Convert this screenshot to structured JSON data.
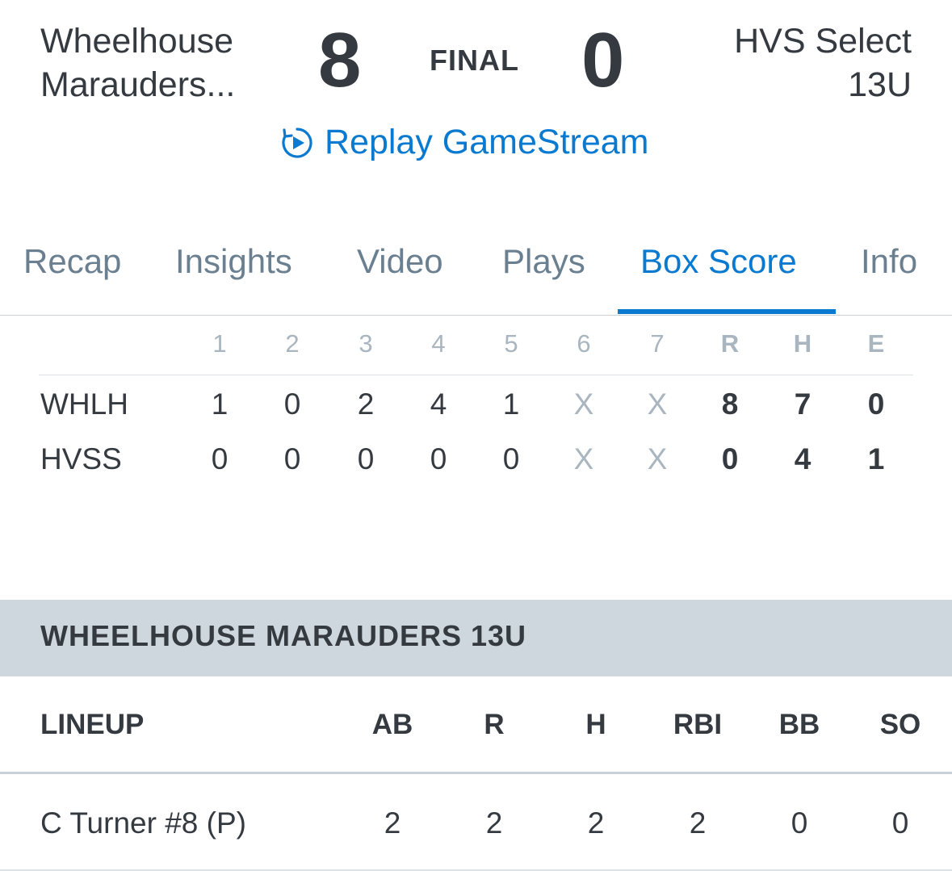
{
  "header": {
    "away_team": "Wheelhouse Marauders...",
    "away_team_line1": "Wheelhouse",
    "away_team_line2": "Marauders...",
    "home_team_line1": "HVS Select",
    "home_team_line2": "13U",
    "away_score": "8",
    "home_score": "0",
    "status": "FINAL",
    "replay_label": "Replay GameStream",
    "replay_icon": "replay-icon",
    "accent_color": "#0a7ad1"
  },
  "tabs": [
    {
      "label": "Recap"
    },
    {
      "label": "Insights"
    },
    {
      "label": "Video"
    },
    {
      "label": "Plays"
    },
    {
      "label": "Box Score",
      "active": true
    },
    {
      "label": "Info"
    }
  ],
  "linescore": {
    "headers": [
      "1",
      "2",
      "3",
      "4",
      "5",
      "6",
      "7",
      "R",
      "H",
      "E"
    ],
    "rows": [
      {
        "team": "WHLH",
        "innings": [
          "1",
          "0",
          "2",
          "4",
          "1",
          "X",
          "X"
        ],
        "R": "8",
        "H": "7",
        "E": "0"
      },
      {
        "team": "HVSS",
        "innings": [
          "0",
          "0",
          "0",
          "0",
          "0",
          "X",
          "X"
        ],
        "R": "0",
        "H": "4",
        "E": "1"
      }
    ]
  },
  "section": {
    "title": "WHEELHOUSE MARAUDERS 13U"
  },
  "lineup": {
    "label": "LINEUP",
    "columns": [
      "AB",
      "R",
      "H",
      "RBI",
      "BB",
      "SO"
    ],
    "rows": [
      {
        "name": "C Turner #8 (P)",
        "stats": [
          "2",
          "2",
          "2",
          "2",
          "0",
          "0"
        ]
      }
    ]
  }
}
